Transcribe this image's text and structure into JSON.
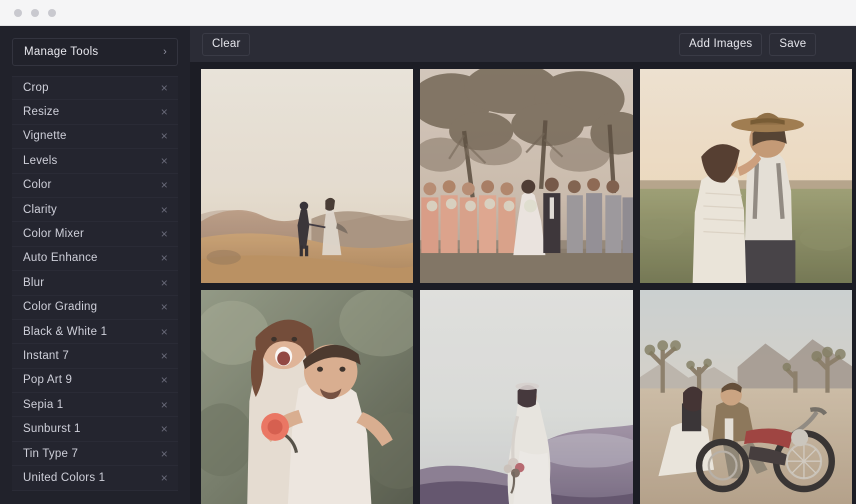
{
  "window": {
    "dots": [
      "window-dot",
      "window-dot",
      "window-dot"
    ]
  },
  "sidebar": {
    "header": {
      "label": "Manage Tools",
      "chevron": "chevron-right-icon"
    },
    "remove_icon": "×",
    "tools": [
      {
        "label": "Crop"
      },
      {
        "label": "Resize"
      },
      {
        "label": "Vignette"
      },
      {
        "label": "Levels"
      },
      {
        "label": "Color"
      },
      {
        "label": "Clarity"
      },
      {
        "label": "Color Mixer"
      },
      {
        "label": "Auto Enhance"
      },
      {
        "label": "Blur"
      },
      {
        "label": "Color Grading"
      },
      {
        "label": "Black & White 1"
      },
      {
        "label": "Instant 7"
      },
      {
        "label": "Pop Art 9"
      },
      {
        "label": "Sepia 1"
      },
      {
        "label": "Sunburst 1"
      },
      {
        "label": "Tin Type 7"
      },
      {
        "label": "United Colors 1"
      }
    ]
  },
  "toolbar": {
    "clear_label": "Clear",
    "add_images_label": "Add Images",
    "save_label": "Save"
  },
  "gallery": {
    "images": [
      {
        "alt": "Couple walking hand in hand on golden hilltop at sunset"
      },
      {
        "alt": "Wedding party under trees, bridesmaids in peach, groomsmen in gray"
      },
      {
        "alt": "Couple kissing in field, man in wide-brim hat and suspenders"
      },
      {
        "alt": "Laughing couple piggyback, man in white shirt with coral flower"
      },
      {
        "alt": "Bride in lace gown on misty hillside"
      },
      {
        "alt": "Couple on red motorcycle in Joshua Tree desert"
      }
    ]
  },
  "colors": {
    "titlebar": "#f5f5f6",
    "sidebar_bg": "#21222b",
    "main_bg": "#2b2c36",
    "grid_bg": "#1c1d25",
    "text": "#cfd0da"
  }
}
